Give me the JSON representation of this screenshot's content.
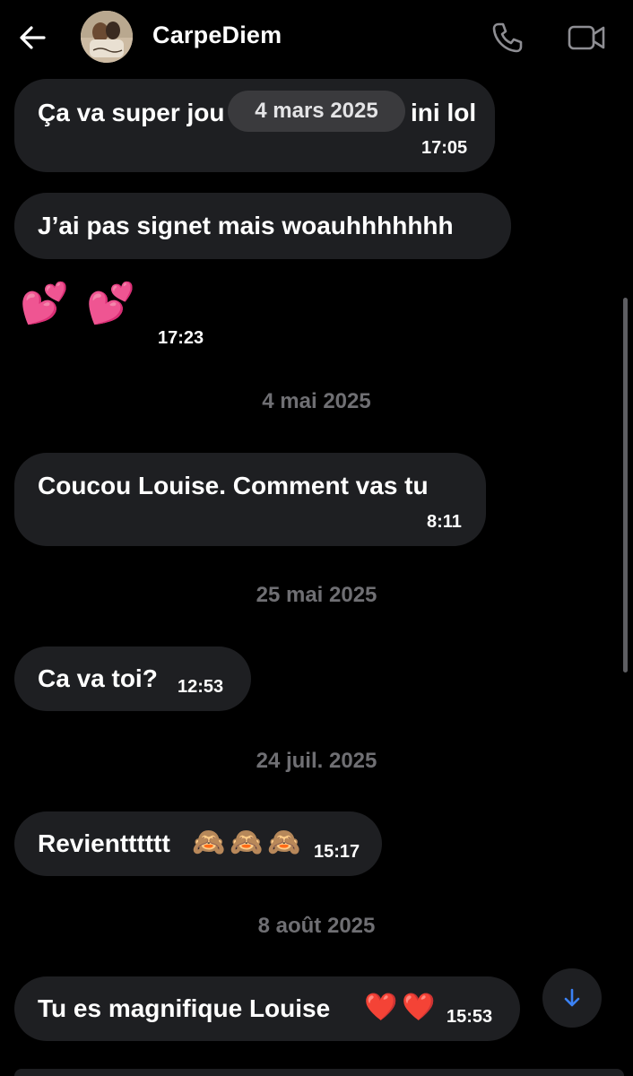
{
  "header": {
    "contact_name": "CarpeDiem",
    "back_icon": "arrow-left-icon",
    "call_icon": "phone-icon",
    "video_icon": "video-camera-icon",
    "icon_color": "#8e8e93"
  },
  "floating_date": "4 mars 2025",
  "messages": [
    {
      "text": "Ça va super jou",
      "text_end": "ini lol",
      "time": "17:05"
    },
    {
      "text": "J’ai pas signet mais woauhhhhhhh",
      "time": ""
    },
    {
      "text": "",
      "emoji": [
        "💕",
        "💕"
      ],
      "time": "17:23"
    },
    {
      "date": "4 mai 2025"
    },
    {
      "text": "Coucou Louise. Comment vas tu",
      "time": "8:11"
    },
    {
      "date": "25 mai 2025"
    },
    {
      "text": "Ca va toi?",
      "time": "12:53"
    },
    {
      "date": "24 juil. 2025"
    },
    {
      "text": "Revientttttt",
      "emoji": [
        "🙈",
        "🙈",
        "🙈"
      ],
      "time": "15:17"
    },
    {
      "date": "8 août 2025"
    },
    {
      "text": "Tu es magnifique Louise",
      "emoji": [
        "❤️",
        "❤️"
      ],
      "time": "15:53"
    }
  ],
  "colors": {
    "background": "#000000",
    "bubble": "#1e1f22",
    "date_separator": "#6f6f73",
    "accent": "#3b82f6"
  },
  "scroll_down_icon": "arrow-down-icon"
}
